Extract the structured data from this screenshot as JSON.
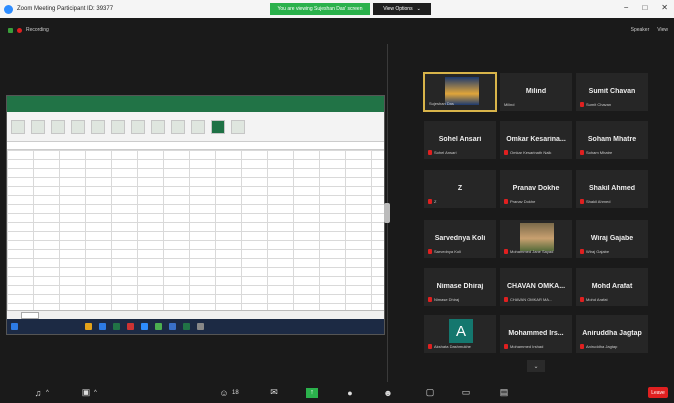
{
  "window": {
    "title": "Zoom Meeting Participant ID: 39377",
    "share_banner": "You are viewing Sujeshan Das' screen",
    "view_options": "View Options",
    "controls": [
      "−",
      "□",
      "✕"
    ]
  },
  "top": {
    "recording_label": "Recording",
    "speaker_view": "Speaker",
    "gallery_view": "View"
  },
  "gallery": {
    "tiles": [
      {
        "big": "",
        "small": "Sujeshan Das",
        "muted": false,
        "type": "photo",
        "active": true
      },
      {
        "big": "Milind",
        "small": "Milind",
        "muted": false,
        "type": "name"
      },
      {
        "big": "Sumit Chavan",
        "small": "Sumit Chavan",
        "muted": true,
        "type": "name"
      },
      {
        "big": "Sohel Ansari",
        "small": "Sohel Ansari",
        "muted": true,
        "type": "name"
      },
      {
        "big": "Omkar Kesarina...",
        "small": "Omkar Kesarinath Naik",
        "muted": true,
        "type": "name"
      },
      {
        "big": "Soham Mhatre",
        "small": "Soham Mhatre",
        "muted": true,
        "type": "name"
      },
      {
        "big": "Z",
        "small": "Z",
        "muted": true,
        "type": "name"
      },
      {
        "big": "Pranav Dokhe",
        "small": "Pranav Dokhe",
        "muted": true,
        "type": "name"
      },
      {
        "big": "Shakil Ahmed",
        "small": "Shakil Ahmed",
        "muted": true,
        "type": "name"
      },
      {
        "big": "Sarvednya Koli",
        "small": "Sarvednya Koli",
        "muted": true,
        "type": "name"
      },
      {
        "big": "",
        "small": "Mohammed Jane Sayad",
        "muted": true,
        "type": "photo2"
      },
      {
        "big": "Wiraj Gajabe",
        "small": "Wiraj Gajabe",
        "muted": true,
        "type": "name"
      },
      {
        "big": "Nimase Dhiraj",
        "small": "Nimase Dhiraj",
        "muted": true,
        "type": "name"
      },
      {
        "big": "CHAVAN OMKA...",
        "small": "CHAVAN OMKAR MA...",
        "muted": true,
        "type": "name"
      },
      {
        "big": "Mohd Arafat",
        "small": "Mohd Arafat",
        "muted": true,
        "type": "name"
      },
      {
        "big": "",
        "small": "Akshata Dashmukhe",
        "muted": true,
        "type": "letter",
        "letter": "A"
      },
      {
        "big": "Mohammed Irs...",
        "small": "Mohammed Irshad",
        "muted": true,
        "type": "name"
      },
      {
        "big": "Aniruddha Jagtap",
        "small": "Aniruddha Jagtap",
        "muted": true,
        "type": "name"
      }
    ],
    "more_arrow": "⌄"
  },
  "toolbar": {
    "audio_label": "^",
    "video_label": "^",
    "participants_count": "18",
    "leave": "Leave"
  },
  "colors": {
    "share_green": "#2bb14c",
    "active_border": "#d8b44a",
    "muted_red": "#e02020",
    "excel_green": "#217346"
  }
}
